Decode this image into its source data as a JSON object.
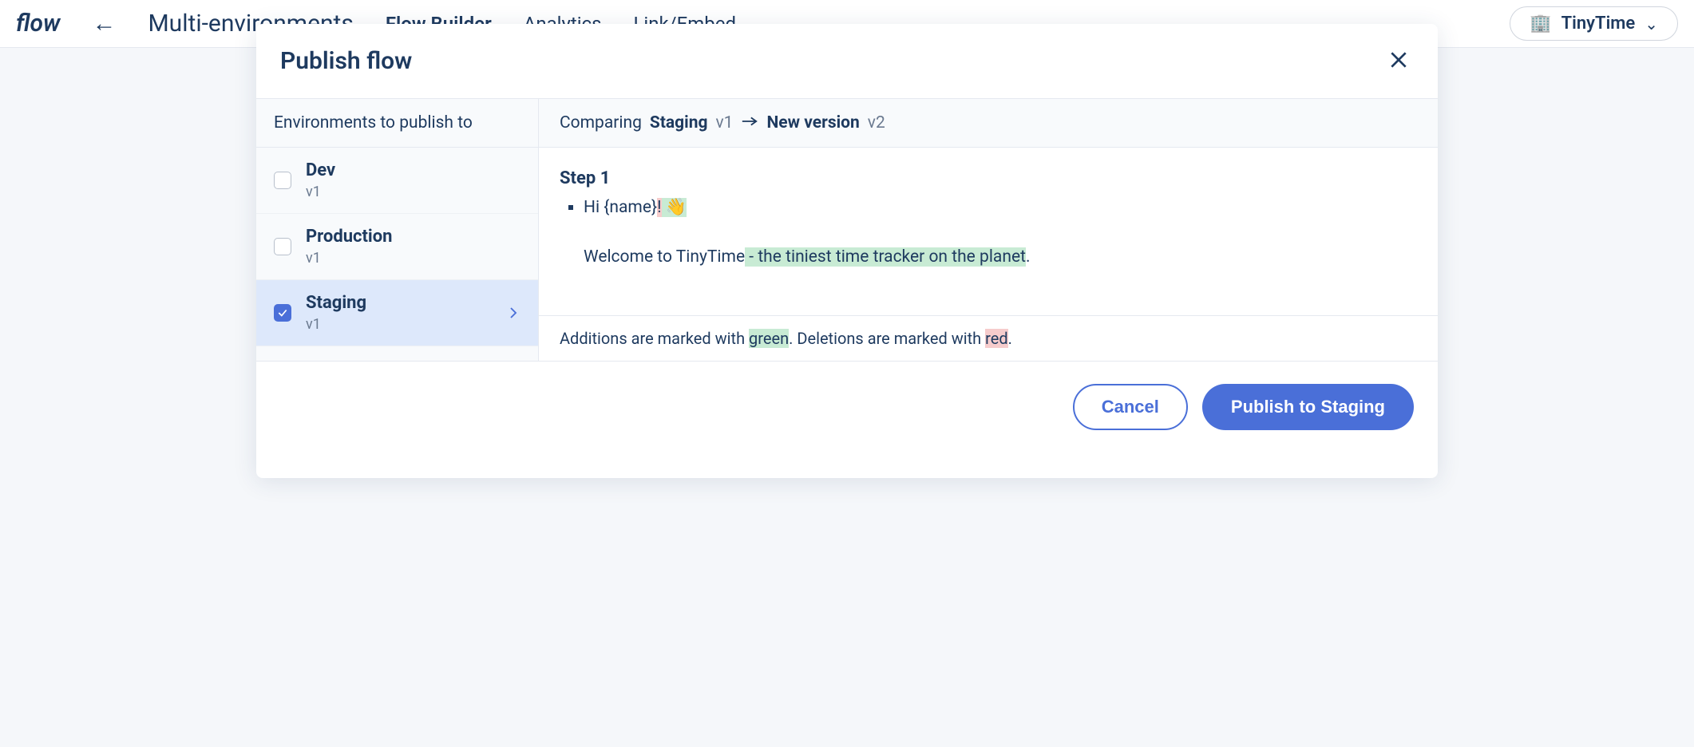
{
  "background": {
    "logo": "flow",
    "flow_title": "Multi-environments",
    "tabs": {
      "builder": "Flow Builder",
      "analytics": "Analytics",
      "link": "Link/Embed"
    },
    "project_name": "TinyTime"
  },
  "modal": {
    "title": "Publish flow",
    "sidebar_header": "Environments to publish to",
    "environments": [
      {
        "name": "Dev",
        "version": "v1",
        "checked": false
      },
      {
        "name": "Production",
        "version": "v1",
        "checked": false
      },
      {
        "name": "Staging",
        "version": "v1",
        "checked": true
      }
    ],
    "compare": {
      "prefix": "Comparing",
      "from_env": "Staging",
      "from_version": "v1",
      "to_label": "New version",
      "to_version": "v2"
    },
    "diff": {
      "step_title": "Step 1",
      "line1_before": "Hi {name}",
      "line1_deleted": "!",
      "line1_added": " 👋",
      "line2_before": "Welcome to TinyTime",
      "line2_added": " - the tiniest time tracker on the planet",
      "line2_after": "."
    },
    "legend": {
      "add_pre": "Additions are marked with ",
      "add_word": "green",
      "del_pre": ". Deletions are marked with ",
      "del_word": "red",
      "suffix": "."
    },
    "footer": {
      "cancel": "Cancel",
      "publish": "Publish to Staging"
    }
  }
}
